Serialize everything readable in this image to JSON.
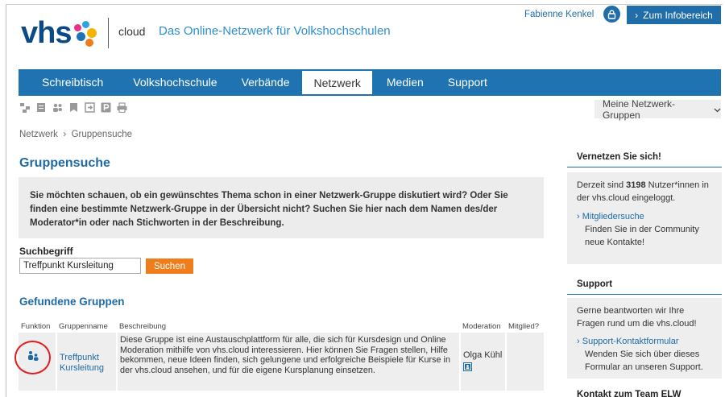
{
  "header": {
    "logo_text": "vhs",
    "logo_sub": "cloud",
    "tagline": "Das Online-Netzwerk für Volkshochschulen",
    "user_name": "Fabienne Kenkel",
    "info_button": "Zum Infobereich"
  },
  "nav": {
    "items": [
      "Schreibtisch",
      "Volkshochschule",
      "Verbände",
      "Netzwerk",
      "Medien",
      "Support"
    ],
    "active": "Netzwerk"
  },
  "toolbar": {
    "icons": [
      "network-icon",
      "document-icon",
      "people-icon",
      "bookmark-icon",
      "login-icon",
      "p-icon",
      "print-icon"
    ]
  },
  "groups_dropdown": {
    "label": "Meine Netzwerk-Gruppen"
  },
  "breadcrumb": {
    "root": "Netzwerk",
    "current": "Gruppensuche"
  },
  "main": {
    "title": "Gruppensuche",
    "intro": "Sie möchten schauen, ob ein gewünschtes Thema schon in einer Netzwerk-Gruppe diskutiert wird? Oder Sie finden eine bestimmte Netzwerk-Gruppe in der Übersicht nicht? Suchen Sie hier nach dem Namen des/der Moderator*in oder nach Stichworten in der Beschreibung.",
    "search_label": "Suchbegriff",
    "search_value": "Treffpunkt Kursleitung",
    "search_button": "Suchen",
    "results_title": "Gefundene Gruppen",
    "columns": [
      "Funktion",
      "Gruppenname",
      "Beschreibung",
      "Moderation",
      "Mitglied?"
    ],
    "rows": [
      {
        "name": "Treffpunkt Kursleitung",
        "description": "Diese Gruppe ist eine Austauschplattform für alle, die sich für Kursdesign und Online Moderation mithilfe von vhs.cloud interessieren. Hier können Sie Fragen stellen, Hilfe bekommen, neue Ideen finden, sich gelungene und erfolgreiche Beispiele für Kurse in der vhs.cloud ansehen, und für die eigene Kursplanung einsetzen.",
        "moderator": "Olga Kühl",
        "member": ""
      }
    ]
  },
  "sidebar": {
    "network": {
      "title": "Vernetzen Sie sich!",
      "text_before": "Derzeit sind ",
      "count": "3198",
      "text_after": " Nutzer*innen in der vhs.cloud eingeloggt.",
      "link": "Mitgliedersuche",
      "link_sub": "Finden Sie in der Community neue Kontakte!"
    },
    "support": {
      "title": "Support",
      "text": "Gerne beantworten wir Ihre Fragen rund um die vhs.cloud!",
      "link": "Support-Kontaktformular",
      "link_sub": "Wenden Sie sich über dieses Formular an unseren Support."
    },
    "contact": {
      "title": "Kontakt zum Team ELW"
    }
  },
  "colors": {
    "brand_blue": "#1e73b0",
    "accent_orange": "#f07d1c",
    "highlight_red": "#e02020"
  }
}
